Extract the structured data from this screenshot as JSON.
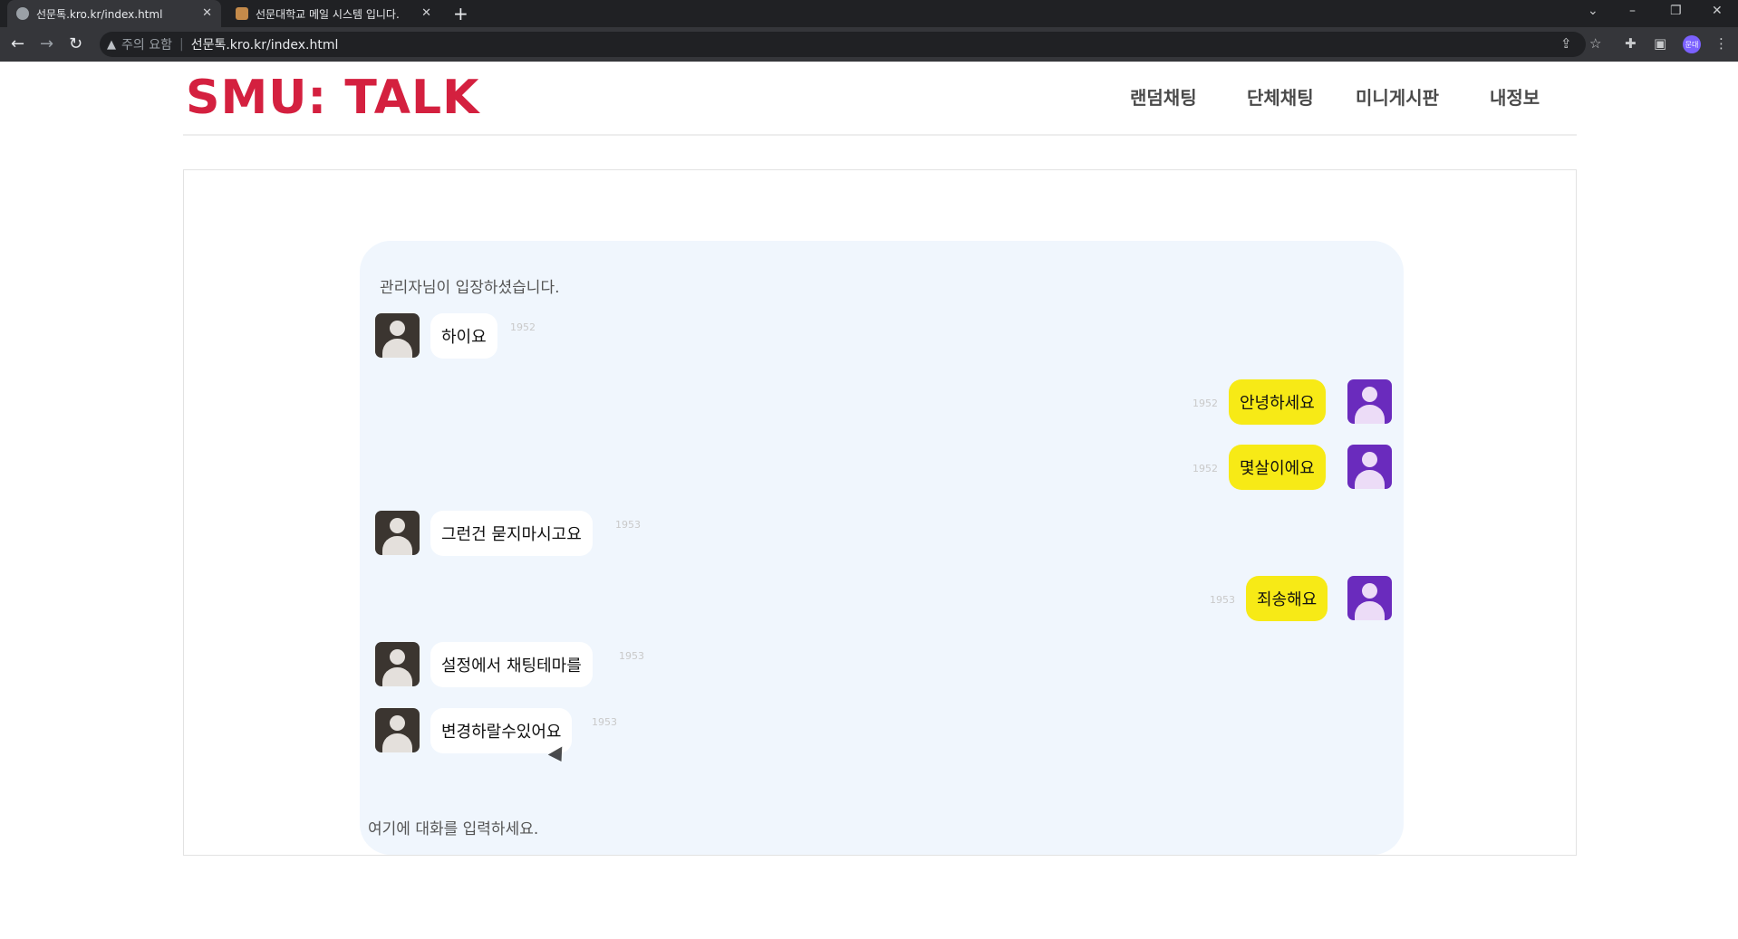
{
  "browser": {
    "tabs": [
      {
        "title": "선문톡.kro.kr/index.html",
        "active": true
      },
      {
        "title": "선문대학교 메일 시스템 입니다.",
        "active": false
      }
    ],
    "new_tab": "+",
    "address_warning": "주의 요함",
    "address_url": "선문톡.kro.kr/index.html",
    "profile_label": "문대",
    "icons": {
      "back": "back-icon",
      "forward": "forward-icon",
      "reload": "reload-icon",
      "share": "share-icon",
      "bookmark": "star-icon",
      "extensions": "puzzle-icon",
      "sidepanel": "side-panel-icon",
      "menu": "more-vert-icon"
    }
  },
  "header": {
    "logo": "SMU: TALK",
    "nav": [
      "랜덤채팅",
      "단체채팅",
      "미니게시판",
      "내정보"
    ]
  },
  "chat": {
    "system_message": "관리자님이 입장하셨습니다.",
    "messages": [
      {
        "side": "left",
        "text": "하이요",
        "time": "1952"
      },
      {
        "side": "right",
        "text": "안녕하세요",
        "time": "1952"
      },
      {
        "side": "right",
        "text": "몇살이에요",
        "time": "1952"
      },
      {
        "side": "left",
        "text": "그런건 묻지마시고요",
        "time": "1953"
      },
      {
        "side": "right",
        "text": "죄송해요",
        "time": "1953"
      },
      {
        "side": "left",
        "text": "설정에서 채팅테마를",
        "time": "1953"
      },
      {
        "side": "left",
        "text": "변경하랄수있어요",
        "time": "1953"
      }
    ],
    "input_placeholder": "여기에 대화를 입력하세요."
  },
  "colors": {
    "brand": "#d4203f",
    "chat_bg": "#f0f6fd",
    "my_bubble": "#f7ea16",
    "other_bubble": "#ffffff",
    "my_avatar": "#6a2bbd",
    "other_avatar": "#3b3530"
  }
}
